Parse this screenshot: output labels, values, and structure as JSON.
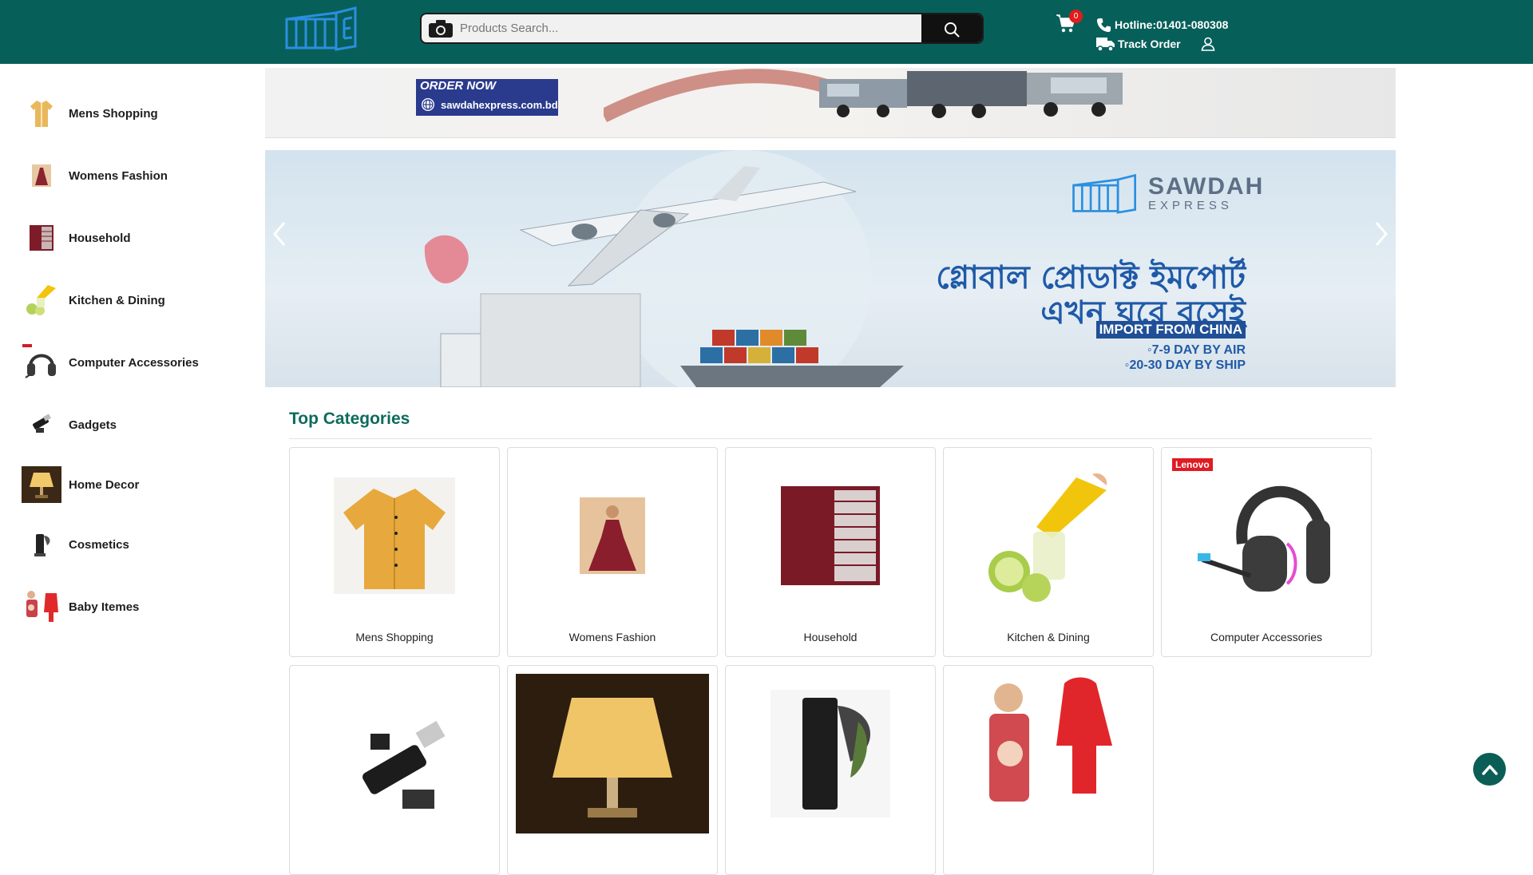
{
  "header": {
    "search_placeholder": "Products Search...",
    "cart_count": "0",
    "hotline": "Hotline:01401-080308",
    "track_order": "Track Order"
  },
  "sidebar": {
    "items": [
      {
        "label": "Mens Shopping",
        "icon": "shirt-icon"
      },
      {
        "label": "Womens Fashion",
        "icon": "dress-icon"
      },
      {
        "label": "Household",
        "icon": "cabinet-icon"
      },
      {
        "label": "Kitchen & Dining",
        "icon": "lemon-squeezer-icon"
      },
      {
        "label": "Computer Accessories",
        "icon": "headset-icon"
      },
      {
        "label": "Gadgets",
        "icon": "gadget-icon"
      },
      {
        "label": "Home Decor",
        "icon": "lamp-icon"
      },
      {
        "label": "Cosmetics",
        "icon": "cosmetics-icon"
      },
      {
        "label": "Baby Itemes",
        "icon": "baby-carrier-icon"
      }
    ]
  },
  "banners": {
    "top": {
      "order_now": "ORDER NOW",
      "url": "sawdahexpress.com.bd"
    },
    "main": {
      "brand": "SAWDAH",
      "brand_sub": "EXPRESS",
      "line1": "গ্লোবাল প্রোডাক্ট ইমপোর্ট",
      "line2": "এখন ঘরে বসেই",
      "import_label": "IMPORT FROM CHINA",
      "air": "◦7-9 DAY BY AIR",
      "ship": "◦20-30 DAY BY SHIP"
    }
  },
  "categories": {
    "title": "Top Categories",
    "items": [
      {
        "label": "Mens Shopping"
      },
      {
        "label": "Womens Fashion"
      },
      {
        "label": "Household"
      },
      {
        "label": "Kitchen & Dining"
      },
      {
        "label": "Computer Accessories",
        "brand_badge": "Lenovo"
      },
      {
        "label": ""
      },
      {
        "label": ""
      },
      {
        "label": ""
      },
      {
        "label": ""
      }
    ]
  },
  "colors": {
    "header_bg": "#075f5a",
    "accent_green": "#0d6b5d",
    "badge_red": "#e21b1b",
    "logo_blue": "#2b8fe0"
  }
}
